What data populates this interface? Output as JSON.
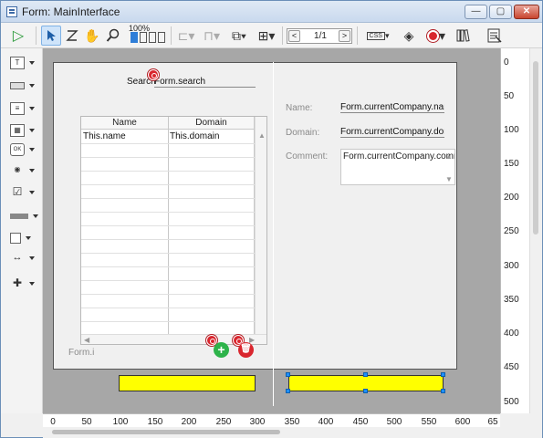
{
  "window": {
    "title": "Form: MainInterface",
    "controls": {
      "minimize": "—",
      "maximize": "▢",
      "close": "✕"
    }
  },
  "toolbar": {
    "run_icon": "play-icon",
    "select_icon": "pointer-icon",
    "zoom_label": "100%",
    "pager_text": "1/1",
    "pager_prev": "<",
    "pager_next": ">",
    "css_label": "CSS"
  },
  "palette": {
    "items": [
      {
        "name": "text-tool",
        "glyph": "T"
      },
      {
        "name": "input-tool",
        "glyph": ""
      },
      {
        "name": "list-tool",
        "glyph": "≡"
      },
      {
        "name": "grid-tool",
        "glyph": "▦"
      },
      {
        "name": "button-tool",
        "glyph": "OK"
      },
      {
        "name": "radio-tool",
        "glyph": "◉"
      },
      {
        "name": "checkbox-tool",
        "glyph": "☑"
      },
      {
        "name": "scrollbar-tool",
        "glyph": "▬"
      },
      {
        "name": "rectangle-tool",
        "glyph": "□"
      },
      {
        "name": "splitter-tool",
        "glyph": "↔"
      },
      {
        "name": "plugin-tool",
        "glyph": "✚"
      }
    ]
  },
  "form": {
    "search_label": "Search",
    "search_value": "Form.search",
    "grid": {
      "columns": [
        "Name",
        "Domain"
      ],
      "rows": [
        [
          "This.name",
          "This.domain"
        ]
      ]
    },
    "footer_label": "Form.i",
    "add_button": "+",
    "delete_button": "🗑",
    "name_label": "Name:",
    "name_value": "Form.currentCompany.name",
    "domain_label": "Domain:",
    "domain_value": "Form.currentCompany.doma",
    "comment_label": "Comment:",
    "comment_value": "Form.currentCompany.comm"
  },
  "rulers": {
    "vertical": [
      "0",
      "50",
      "100",
      "150",
      "200",
      "250",
      "300",
      "350",
      "400",
      "450",
      "500"
    ],
    "horizontal": [
      "0",
      "50",
      "100",
      "150",
      "200",
      "250",
      "300",
      "350",
      "400",
      "450",
      "500",
      "550",
      "600",
      "65"
    ]
  },
  "colors": {
    "accent": "#1e90ff",
    "badge": "#d9262e",
    "add": "#2db34a",
    "delete": "#d9262e",
    "yellow": "#ffff00"
  }
}
